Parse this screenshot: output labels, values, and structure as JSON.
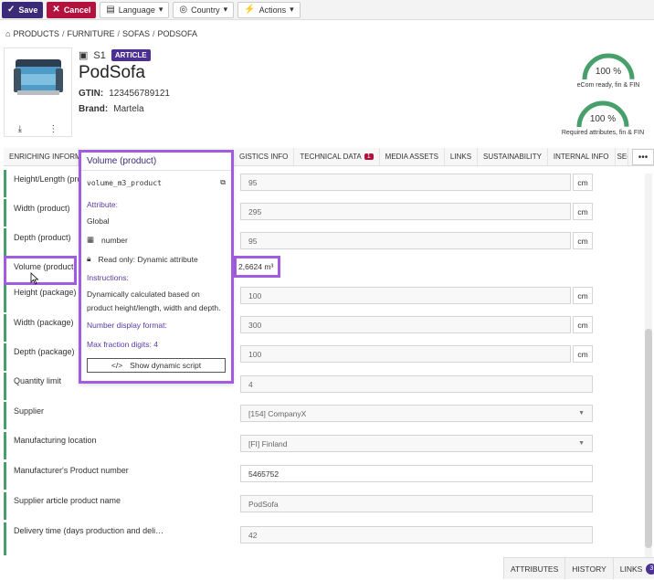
{
  "toolbar": {
    "save_label": "Save",
    "cancel_label": "Cancel",
    "language_label": "Language",
    "country_label": "Country",
    "actions_label": "Actions"
  },
  "breadcrumb": [
    "PRODUCTS",
    "FURNITURE",
    "SOFAS",
    "PODSOFA"
  ],
  "product": {
    "sku": "S1",
    "badge": "ARTICLE",
    "name": "PodSofa",
    "gtin_label": "GTIN:",
    "gtin_value": "123456789121",
    "brand_label": "Brand:",
    "brand_value": "Martela"
  },
  "gauges": [
    {
      "percent": 100,
      "text": "100 %",
      "caption": "eCom ready, fin & FIN"
    },
    {
      "percent": 100,
      "text": "100 %",
      "caption": "Required attributes, fin & FIN"
    }
  ],
  "tabs": [
    {
      "label": "ENRICHING INFORM"
    },
    {
      "label": "GISTICS INFO"
    },
    {
      "label": "TECHNICAL DATA",
      "count": "1"
    },
    {
      "label": "MEDIA ASSETS"
    },
    {
      "label": "LINKS"
    },
    {
      "label": "SUSTAINABILITY"
    },
    {
      "label": "INTERNAL INFO"
    },
    {
      "label": "SE("
    }
  ],
  "rows": [
    {
      "label": "Height/Length (pro",
      "value": "95",
      "unit": "cm"
    },
    {
      "label": "Width (product)",
      "value": "295",
      "unit": "cm"
    },
    {
      "label": "Depth (product)",
      "value": "95",
      "unit": "cm"
    },
    {
      "label": "Volume (product)",
      "value": "2,6624 m³"
    },
    {
      "label": "Height (package)",
      "value": "100",
      "unit": "cm"
    },
    {
      "label": "Width (package)",
      "value": "300",
      "unit": "cm"
    },
    {
      "label": "Depth (package)",
      "value": "100",
      "unit": "cm"
    },
    {
      "label": "Quantity limit",
      "value": "4"
    },
    {
      "label": "Supplier",
      "value": "[154] CompanyX"
    },
    {
      "label": "Manufacturing location",
      "value": "[FI] Finland"
    },
    {
      "label": "Manufacturer's Product number",
      "value": "5465752"
    },
    {
      "label": "Supplier article product name",
      "value": "PodSofa"
    },
    {
      "label": "Delivery time (days production and deli…",
      "value": "42"
    }
  ],
  "popup": {
    "title": "Volume (product)",
    "code": "volume_m3_product",
    "attribute_label": "Attribute:",
    "scope": "Global",
    "type": "number",
    "readonly": "Read only: Dynamic attribute",
    "instructions_label": "Instructions:",
    "instructions": "Dynamically calculated based on product height/length, width and depth.",
    "format_label": "Number display format:",
    "format_value": "Max fraction digits: 4",
    "script_button": "Show dynamic script"
  },
  "bottom_tabs": {
    "attributes": "ATTRIBUTES",
    "history": "HISTORY",
    "links": "LINKS",
    "links_count": "3"
  },
  "colors": {
    "primary": "#3b2a77",
    "danger": "#b3123e",
    "highlight": "#a25ce0",
    "success": "#47a06c"
  }
}
